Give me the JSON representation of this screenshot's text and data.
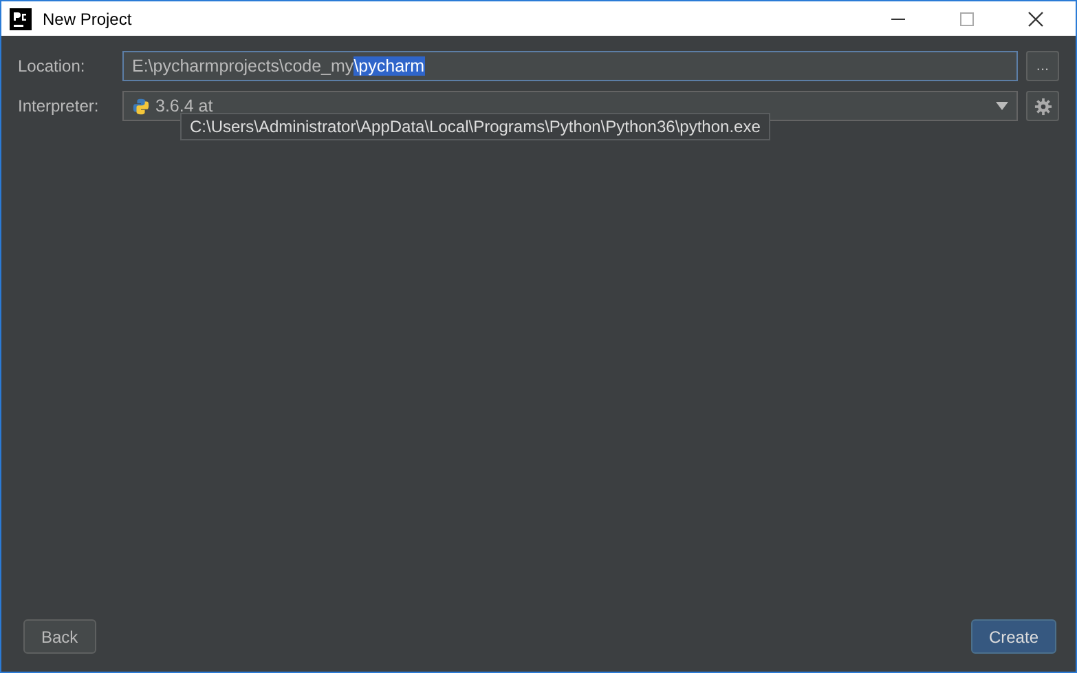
{
  "window": {
    "title": "New Project"
  },
  "location": {
    "label": "Location:",
    "value_parts": [
      {
        "text": "E:\\pycharmprojects\\code_my",
        "selected": false
      },
      {
        "text": "\\pycharm",
        "selected": true
      }
    ],
    "browse_button": "..."
  },
  "interpreter": {
    "label": "Interpreter:",
    "value": "3.6.4 at",
    "tooltip": "C:\\Users\\Administrator\\AppData\\Local\\Programs\\Python\\Python36\\python.exe"
  },
  "buttons": [
    {
      "label": "Back",
      "kind": "secondary"
    },
    {
      "label": "Create",
      "kind": "primary"
    }
  ]
}
